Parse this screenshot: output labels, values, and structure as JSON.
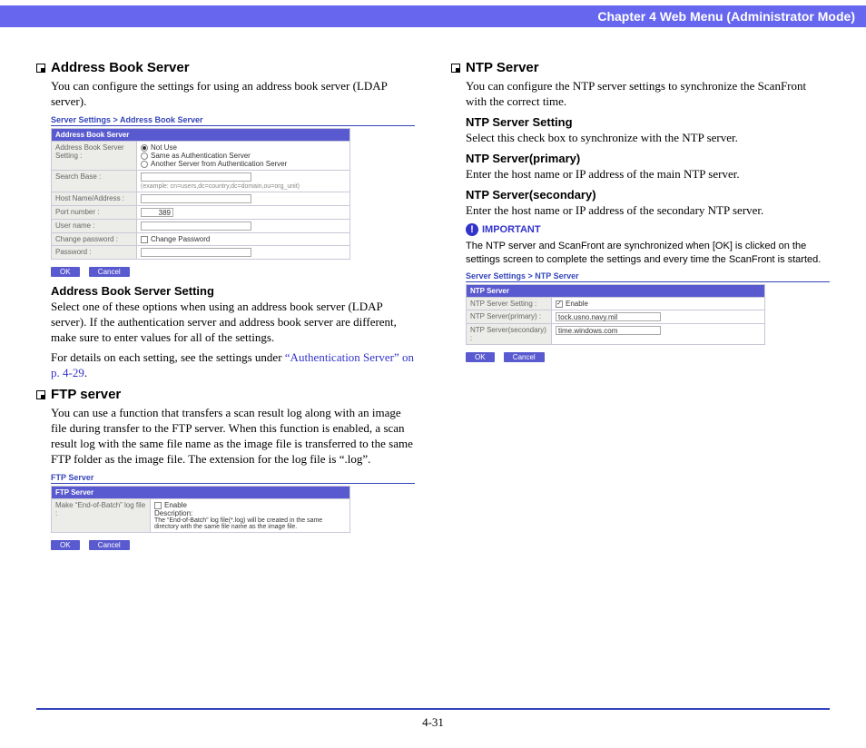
{
  "header": "Chapter 4   Web Menu (Administrator Mode)",
  "page_number": "4-31",
  "left": {
    "s1": {
      "title": "Address Book Server",
      "intro": "You can configure the settings for using an address book server (LDAP server).",
      "sub_title": "Address Book Server Setting",
      "sub_body1": "Select one of these options when using an address book server (LDAP server). If the authentication server and address book server are different, make sure to enter values for all of the settings.",
      "sub_body2a": "For details on each setting, see the settings under ",
      "sub_body2_link": "“Authentication Server” on p. 4-29",
      "sub_body2b": "."
    },
    "shot1": {
      "crumb": "Server Settings > Address Book Server",
      "thead": "Address Book Server",
      "r1_label": "Address Book Server Setting :",
      "r1_opt1": "Not Use",
      "r1_opt2": "Same as Authentication Server",
      "r1_opt3": "Another Server from Authentication Server",
      "r2_label": "Search Base :",
      "r2_hint": "(example: cn=users,dc=country,dc=domain,ou=org_unit)",
      "r3_label": "Host Name/Address :",
      "r4_label": "Port number :",
      "r4_val": "389",
      "r5_label": "User name :",
      "r6_label": "Change password :",
      "r6_opt": "Change Password",
      "r7_label": "Password :",
      "ok": "OK",
      "cancel": "Cancel"
    },
    "s2": {
      "title": "FTP server",
      "intro": "You can use a function that transfers a scan result log along with an image file during transfer to the FTP server. When this function is enabled, a scan result log with the same file name as the image file is transferred to the same FTP folder as the image file. The extension for the log file is “.log”."
    },
    "shot2": {
      "crumb": "FTP Server",
      "thead": "FTP Server",
      "r1_label": "Make “End-of-Batch” log file :",
      "r1_opt": "Enable",
      "r1_desc_label": "Description:",
      "r1_desc": "The “End-of-Batch” log file(*.log) will be created in the same directory with the same file name as the image file.",
      "ok": "OK",
      "cancel": "Cancel"
    }
  },
  "right": {
    "s1": {
      "title": "NTP Server",
      "intro": "You can configure the NTP server settings to synchronize the ScanFront with the correct time.",
      "h1": "NTP Server Setting",
      "b1": "Select this check box to synchronize with the NTP server.",
      "h2": "NTP Server(primary)",
      "b2": "Enter the host name or IP address of the main NTP server.",
      "h3": "NTP Server(secondary)",
      "b3": "Enter the host name or IP address of the secondary NTP server.",
      "important_label": "IMPORTANT",
      "important_text": "The NTP server and ScanFront are synchronized when [OK] is clicked on the settings screen to complete the settings and every time the ScanFront is started."
    },
    "shot3": {
      "crumb": "Server Settings > NTP Server",
      "thead": "NTP Server",
      "r1_label": "NTP Server Setting :",
      "r1_opt": "Enable",
      "r2_label": "NTP Server(primary) :",
      "r2_val": "tock.usno.navy.mil",
      "r3_label": "NTP Server(secondary) :",
      "r3_val": "time.windows.com",
      "ok": "OK",
      "cancel": "Cancel"
    }
  }
}
